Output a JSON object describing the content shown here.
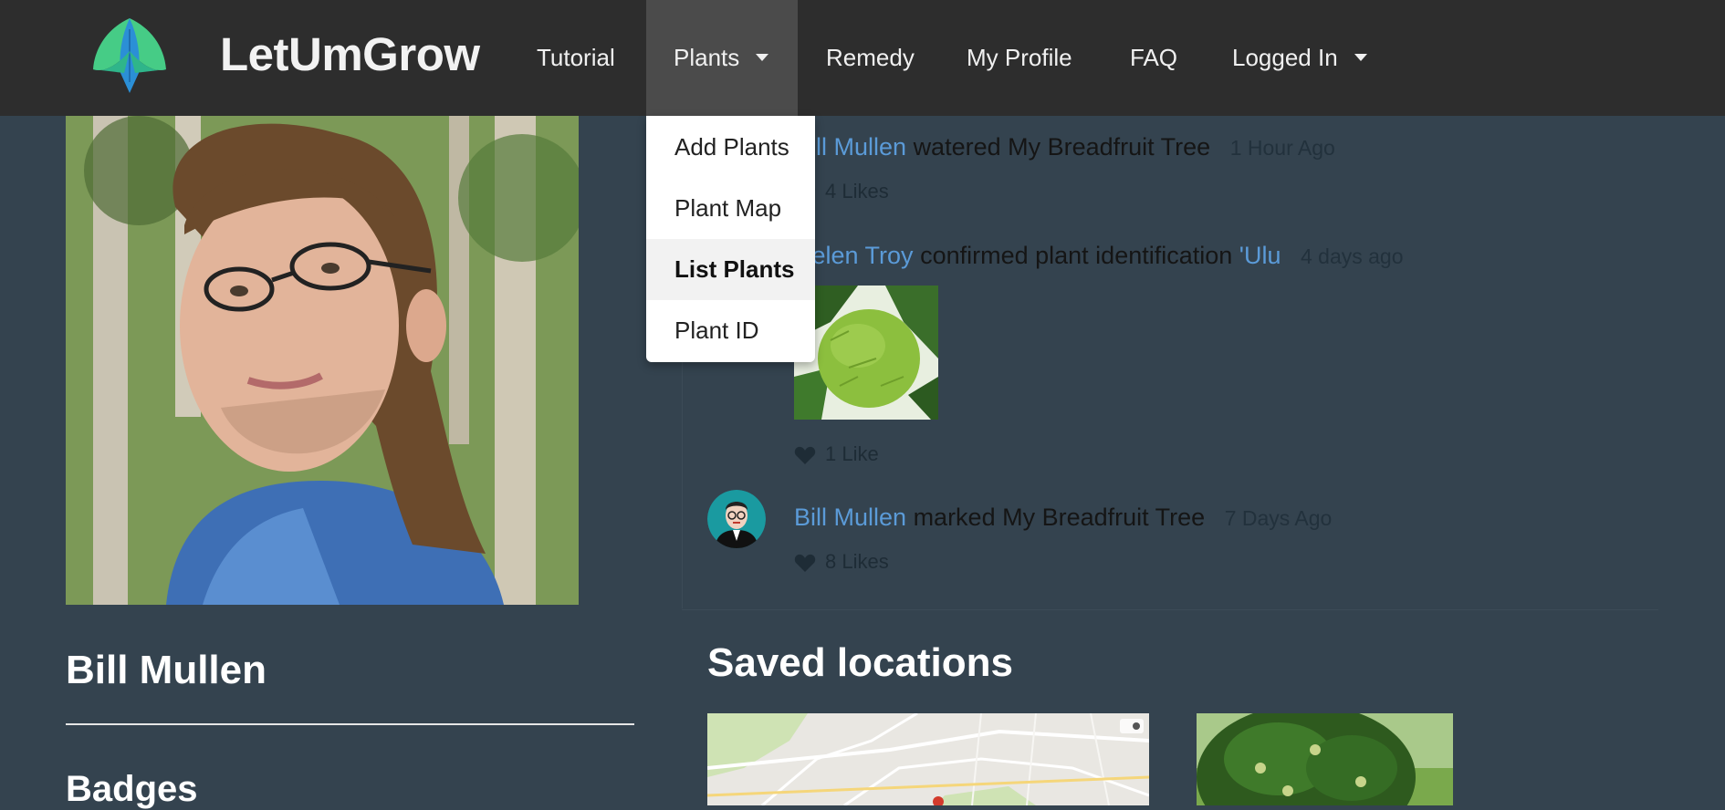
{
  "nav": {
    "brand": "LetUmGrow",
    "items": [
      {
        "label": "Tutorial"
      },
      {
        "label": "Plants"
      },
      {
        "label": "Remedy"
      },
      {
        "label": "My Profile"
      },
      {
        "label": "FAQ"
      },
      {
        "label": "Logged In"
      }
    ]
  },
  "plants_dropdown": {
    "items": [
      {
        "label": "Add Plants"
      },
      {
        "label": "Plant Map"
      },
      {
        "label": "List Plants"
      },
      {
        "label": "Plant ID"
      }
    ],
    "highlighted": "List Plants"
  },
  "profile": {
    "name": "Bill Mullen",
    "badges_heading": "Badges"
  },
  "feed": [
    {
      "user": "Bill Mullen",
      "action": "watered My Breadfruit Tree",
      "object": "",
      "time": "1 Hour Ago",
      "likes": "4 Likes"
    },
    {
      "user": "Helen Troy",
      "action": "confirmed plant identification",
      "object": "'Ulu",
      "time": "4 days ago",
      "likes": "1 Like"
    },
    {
      "user": "Bill Mullen",
      "action": "marked My Breadfruit Tree",
      "object": "",
      "time": "7 Days Ago",
      "likes": "8 Likes"
    }
  ],
  "saved_locations": {
    "heading": "Saved locations"
  },
  "colors": {
    "navbar": "#2d2d2d",
    "background": "#34434f",
    "link": "#5b9bd8",
    "logo_green": "#3ec97a",
    "logo_blue": "#2b8fd6"
  }
}
